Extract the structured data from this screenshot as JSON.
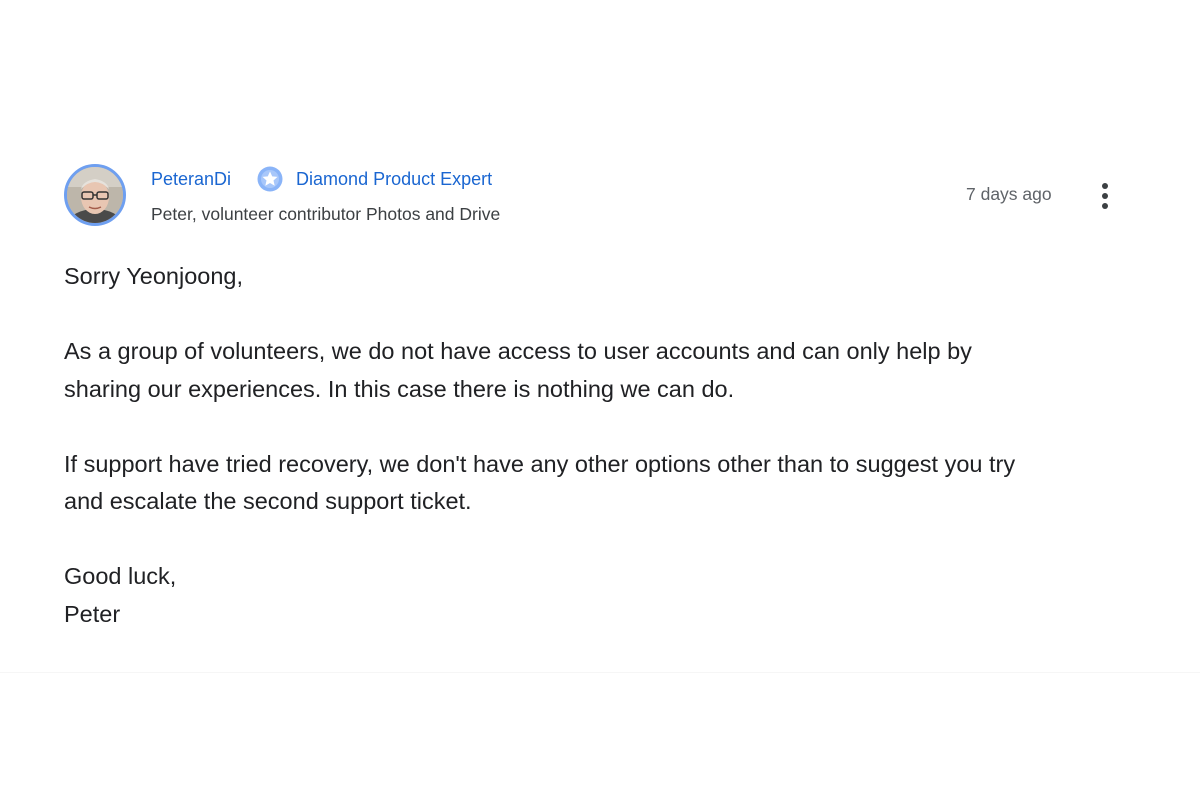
{
  "author": {
    "name": "PeteranDi",
    "badge_icon": "diamond-badge-icon",
    "badge_label": "Diamond Product Expert",
    "subtitle": "Peter, volunteer contributor Photos and Drive",
    "avatar_icon": "user-avatar"
  },
  "post_meta": {
    "timestamp": "7 days ago",
    "menu_icon": "more-vert-icon"
  },
  "message": {
    "greeting": "Sorry Yeonjoong,",
    "paragraph_1": [
      "As a group of volunteers, we do not have access to user accounts and can only help by",
      "sharing our experiences. In this case there is nothing we can do."
    ],
    "paragraph_2": [
      "If support have tried recovery, we don't have any other options other than to suggest you try",
      "and escalate the second support ticket."
    ],
    "closing": "Good luck,",
    "signature": "Peter"
  },
  "colors": {
    "link_blue": "#1a66d1",
    "badge_blue": "#8ab4f8",
    "avatar_ring": "#6e9ff0",
    "text_primary": "#202124",
    "text_secondary": "#5f6368"
  }
}
